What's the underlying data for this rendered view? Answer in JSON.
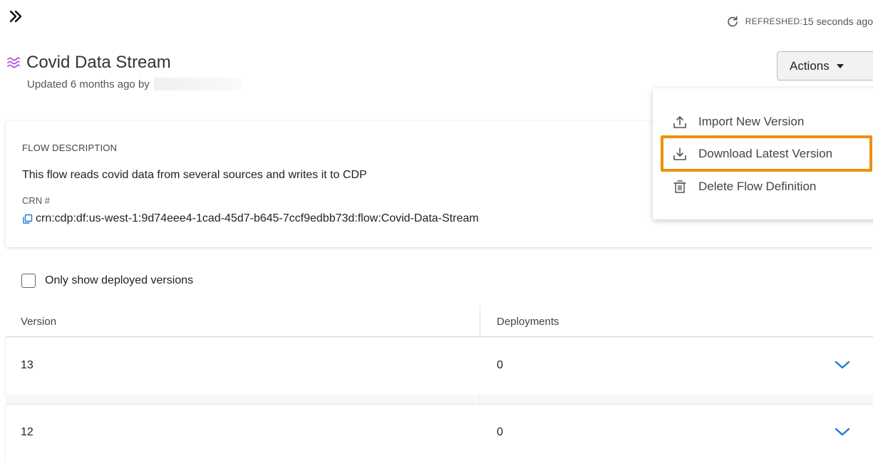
{
  "topbar": {
    "expand_icon": "double-chevron-right-icon",
    "refresh_icon": "refresh-icon",
    "refreshed_label": "REFRESHED:",
    "refreshed_value": "15 seconds ago"
  },
  "header": {
    "title_icon": "stream-waves-icon",
    "title": "Covid Data Stream",
    "updated_text": "Updated 6 months ago by",
    "title_icon_color": "#b04fe0"
  },
  "actions": {
    "button_label": "Actions",
    "menu": [
      {
        "label": "Import New Version",
        "icon": "upload-icon"
      },
      {
        "label": "Download Latest Version",
        "icon": "download-icon"
      },
      {
        "label": "Delete Flow Definition",
        "icon": "trash-icon"
      }
    ],
    "highlight_color": "#f0900c",
    "highlighted_item": "Download Latest Version"
  },
  "description": {
    "label": "FLOW DESCRIPTION",
    "text": "This flow reads covid data from several sources and writes it to CDP",
    "crn_label": "CRN #",
    "crn_icon": "copy-icon",
    "crn_value": "crn:cdp:df:us-west-1:9d74eee4-1cad-45d7-b645-7ccf9edbb73d:flow:Covid-Data-Stream"
  },
  "filter": {
    "checkbox_label": "Only show deployed versions",
    "checked": false
  },
  "table": {
    "columns": [
      "Version",
      "Deployments"
    ],
    "rows": [
      {
        "version": "13",
        "deployments": "0"
      },
      {
        "version": "12",
        "deployments": "0"
      }
    ],
    "accent_color": "#1f7ad6"
  }
}
